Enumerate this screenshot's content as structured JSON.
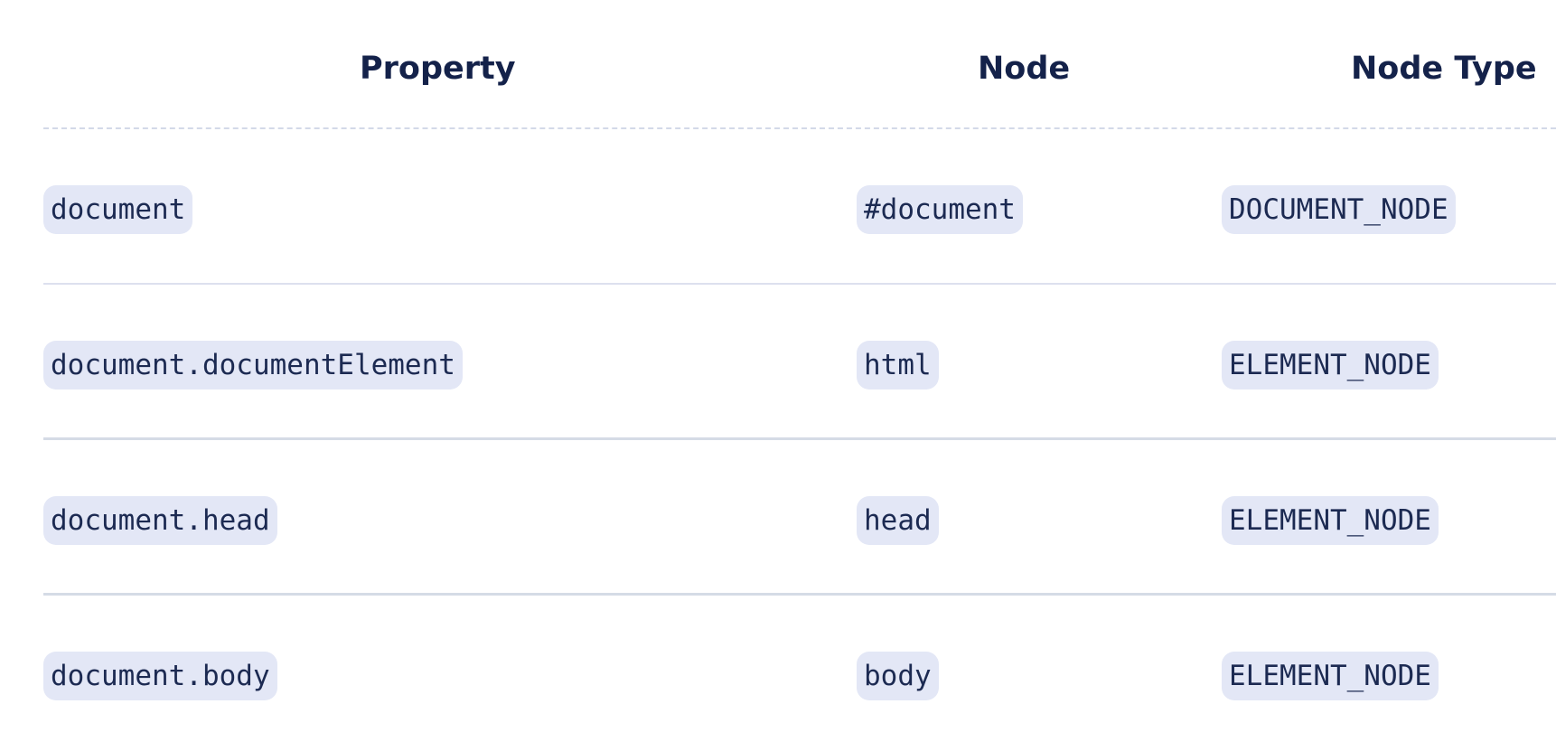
{
  "table": {
    "headers": {
      "property": "Property",
      "node": "Node",
      "node_type": "Node Type"
    },
    "rows": [
      {
        "property": "document",
        "node": "#document",
        "node_type": "DOCUMENT_NODE"
      },
      {
        "property": "document.documentElement",
        "node": "html",
        "node_type": "ELEMENT_NODE"
      },
      {
        "property": "document.head",
        "node": "head",
        "node_type": "ELEMENT_NODE"
      },
      {
        "property": "document.body",
        "node": "body",
        "node_type": "ELEMENT_NODE"
      }
    ]
  }
}
